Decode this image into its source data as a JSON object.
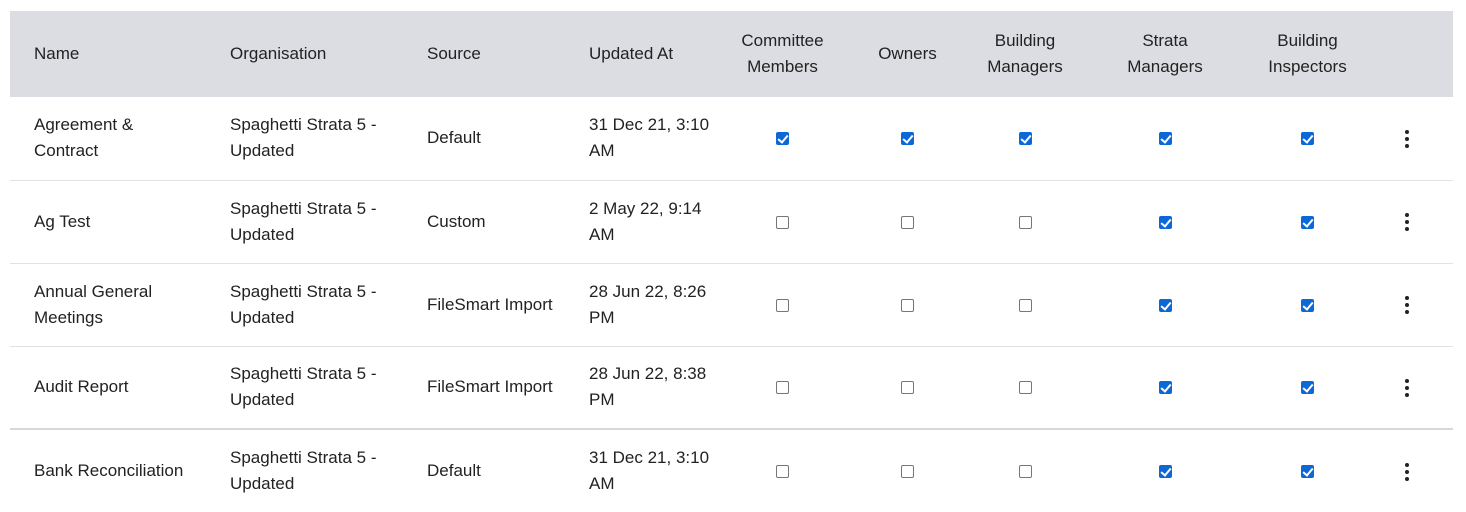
{
  "table": {
    "headers": {
      "name": "Name",
      "organisation": "Organisation",
      "source": "Source",
      "updated_at": "Updated At",
      "committee_members_1": "Committee",
      "committee_members_2": "Members",
      "owners": "Owners",
      "building_managers_1": "Building",
      "building_managers_2": "Managers",
      "strata_managers_1": "Strata",
      "strata_managers_2": "Managers",
      "building_inspectors_1": "Building",
      "building_inspectors_2": "Inspectors"
    },
    "rows": [
      {
        "name_1": "Agreement &",
        "name_2": "Contract",
        "organisation_1": "Spaghetti Strata 5 -",
        "organisation_2": "Updated",
        "source": "Default",
        "updated_1": "31 Dec 21, 3:10",
        "updated_2": "AM",
        "committee_members": true,
        "owners": true,
        "building_managers": true,
        "strata_managers": true,
        "building_inspectors": true
      },
      {
        "name_1": "Ag Test",
        "name_2": "",
        "organisation_1": "Spaghetti Strata 5 -",
        "organisation_2": "Updated",
        "source": "Custom",
        "updated_1": "2 May 22, 9:14",
        "updated_2": "AM",
        "committee_members": false,
        "owners": false,
        "building_managers": false,
        "strata_managers": true,
        "building_inspectors": true
      },
      {
        "name_1": "Annual General",
        "name_2": "Meetings",
        "organisation_1": "Spaghetti Strata 5 -",
        "organisation_2": "Updated",
        "source": "FileSmart Import",
        "updated_1": "28 Jun 22, 8:26",
        "updated_2": "PM",
        "committee_members": false,
        "owners": false,
        "building_managers": false,
        "strata_managers": true,
        "building_inspectors": true
      },
      {
        "name_1": "Audit Report",
        "name_2": "",
        "organisation_1": "Spaghetti Strata 5 -",
        "organisation_2": "Updated",
        "source": "FileSmart Import",
        "updated_1": "28 Jun 22, 8:38",
        "updated_2": "PM",
        "committee_members": false,
        "owners": false,
        "building_managers": false,
        "strata_managers": true,
        "building_inspectors": true
      },
      {
        "name_1": "Bank Reconciliation",
        "name_2": "",
        "organisation_1": "Spaghetti Strata 5 -",
        "organisation_2": "Updated",
        "source": "Default",
        "updated_1": "31 Dec 21, 3:10",
        "updated_2": "AM",
        "committee_members": false,
        "owners": false,
        "building_managers": false,
        "strata_managers": true,
        "building_inspectors": true
      }
    ]
  },
  "icons": {
    "row_menu": "kebab-menu-icon"
  },
  "colors": {
    "header_bg": "#dcdde2",
    "checkbox_checked": "#0b68d6"
  }
}
